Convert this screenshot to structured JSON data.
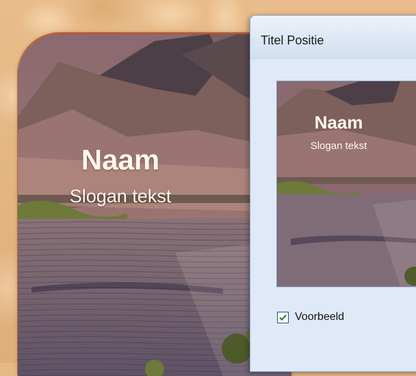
{
  "dialog": {
    "title": "Titel Positie",
    "checkbox_label": "Voorbeeld",
    "checkbox_checked": true
  },
  "page": {
    "name": "Naam",
    "slogan": "Slogan tekst"
  },
  "preview": {
    "name": "Naam",
    "slogan": "Slogan tekst"
  },
  "colors": {
    "background": "#e6b886",
    "dialog": "#dbe7f7",
    "checkmark": "#1e8a2a"
  }
}
